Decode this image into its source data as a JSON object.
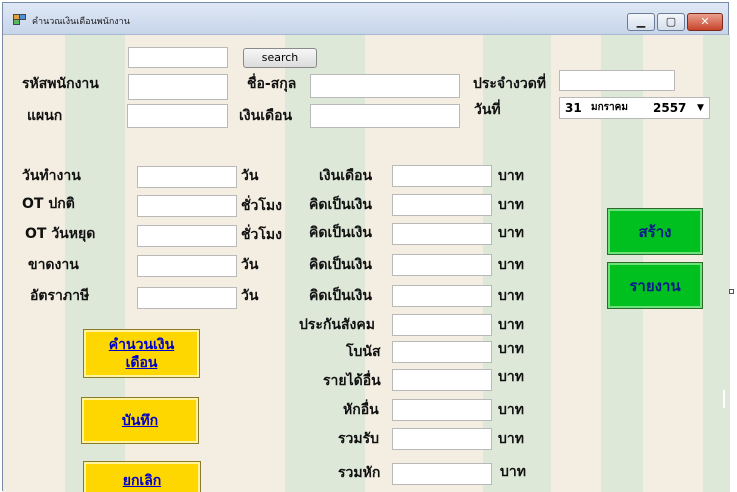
{
  "window": {
    "title": "คำนวณเงินเดือนพนักงาน",
    "controls": {
      "minimize": "▁",
      "maximize": "▢",
      "close": "✕"
    }
  },
  "search": {
    "value": "",
    "button_label": "search"
  },
  "employee": {
    "id_label": "รหัสพนักงาน",
    "id_value": "",
    "name_label": "ชื่อ-สกุล",
    "name_value": "",
    "dept_label": "แผนก",
    "dept_value": "",
    "salary_label": "เงินเดือน",
    "salary_value": "",
    "period_label": "ประจำงวดที่",
    "period_value": "",
    "date_label": "วันที่",
    "date": {
      "day": "31",
      "month": "มกราคม",
      "year": "2557"
    }
  },
  "work": {
    "rows": [
      {
        "label": "วันทำงาน",
        "unit": "วัน"
      },
      {
        "label": "OT ปกติ",
        "unit": "ชั่วโมง"
      },
      {
        "label": "OT วันหยุด",
        "unit": "ชั่วโมง"
      },
      {
        "label": "ขาดงาน",
        "unit": "วัน"
      },
      {
        "label": "อัตราภาษี",
        "unit": "วัน"
      }
    ]
  },
  "money": {
    "currency": "บาท",
    "rows": [
      {
        "label": "เงินเดือน"
      },
      {
        "label": "คิดเป็นเงิน"
      },
      {
        "label": "คิดเป็นเงิน"
      },
      {
        "label": "คิดเป็นเงิน"
      },
      {
        "label": "คิดเป็นเงิน"
      },
      {
        "label": "ประกันสังคม"
      },
      {
        "label": "โบนัส"
      },
      {
        "label": "รายได้อื่น"
      },
      {
        "label": "หักอื่น"
      },
      {
        "label": "รวมรับ"
      },
      {
        "label": "รวมหัก"
      }
    ]
  },
  "actions": {
    "calculate": "คำนวนเงินเดือน",
    "save": "บันทึก",
    "cancel": "ยกเลิก",
    "create": "สร้าง",
    "report": "รายงาน"
  },
  "colors": {
    "yellow": "#ffd700",
    "green": "#00c020",
    "link_blue": "#0000cc"
  }
}
